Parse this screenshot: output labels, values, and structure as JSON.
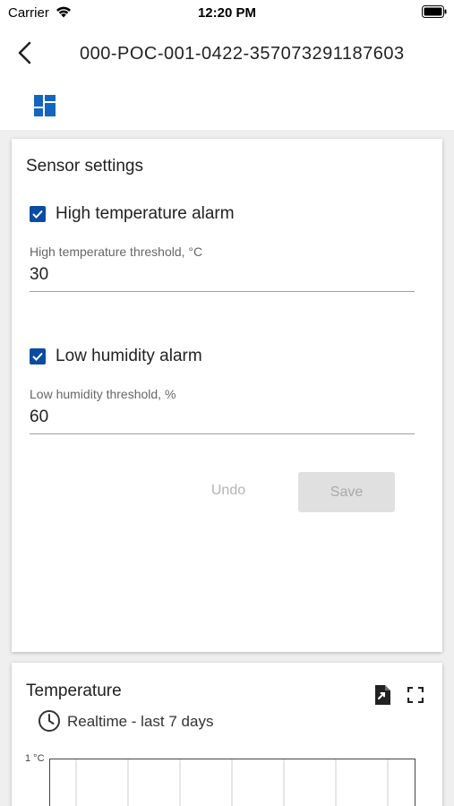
{
  "status_bar": {
    "carrier": "Carrier",
    "time": "12:20 PM"
  },
  "header": {
    "title": "000-POC-001-0422-357073291187603",
    "back_icon": "chevron-left-icon",
    "tab_icon": "dashboard-icon"
  },
  "sensor_settings": {
    "title": "Sensor settings",
    "high_temp": {
      "checkbox_label": "High temperature alarm",
      "checked": true,
      "threshold_label": "High temperature threshold, °C",
      "threshold_value": "30"
    },
    "low_humidity": {
      "checkbox_label": "Low humidity alarm",
      "checked": true,
      "threshold_label": "Low humidity threshold, %",
      "threshold_value": "60"
    },
    "undo_label": "Undo",
    "save_label": "Save"
  },
  "temperature": {
    "title": "Temperature",
    "range_label": "Realtime - last 7 days",
    "y_tick": "1 °C"
  },
  "colors": {
    "accent": "#0a4ca3",
    "background": "#efefef"
  }
}
